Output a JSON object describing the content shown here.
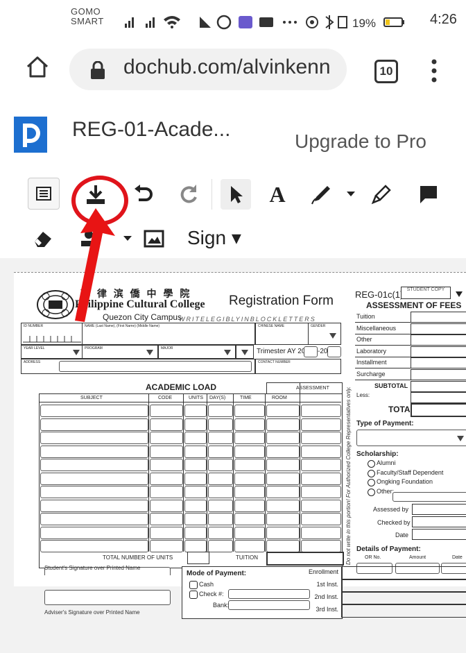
{
  "status_bar": {
    "carrier_line1": "GOMO",
    "carrier_line2": "SMART",
    "icons_text": "▐ıl ▐ıl ◥ ≡ ✓ ◎ ■ ▶ ··· ◉ ✱ ▯ 19%",
    "battery": "19%",
    "time": "4:26"
  },
  "browser": {
    "url": "dochub.com/alvinkenn",
    "tab_count": "10"
  },
  "app": {
    "doc_title": "REG-01-Acade...",
    "upgrade_label": "Upgrade to Pro",
    "sign_label": "Sign ▾"
  },
  "form": {
    "school_chinese": "菲 律 滨 僑 中 學 院",
    "school_name": "Philippine Cultural College",
    "campus": "Quezon City Campus",
    "write_note": "WRITELEGIBLYINBLOCKLETTERS",
    "form_title": "Registration Form",
    "form_code": "REG-01c(1)",
    "copy_label": "STUDENT COPY",
    "id_label": "ID NUMBER",
    "name_label": "NAME (Last Name), (First Name) (Middle Name)",
    "chinese_name_label": "CHINESE NAME",
    "gender_label": "GENDER",
    "year_level_label": "YEAR LEVEL",
    "program_label": "PROGRAM",
    "major_label": "MAJOR",
    "trimester_label": "Trimester AY 20",
    "trimester_dash": "-20",
    "address_label": "ADDRESS",
    "contact_label": "CONTACT NUMBER",
    "academic_load": "ACADEMIC LOAD",
    "assessment_col": "ASSESSMENT",
    "columns": [
      "SUBJECT",
      "CODE",
      "UNITS",
      "DAY(S)",
      "TIME",
      "ROOM"
    ],
    "total_units_label": "TOTAL NUMBER OF UNITS",
    "tuition_label": "TUITION",
    "student_sig": "Student's Signature over Printed Name",
    "adviser_sig": "Adviser's Signature over Printed Name",
    "mode_of_payment": "Mode of Payment:",
    "cash_label": "Cash",
    "check_label": "Check #:",
    "bank_label": "Bank:",
    "installments": [
      "Enrollment",
      "1st Inst.",
      "2nd Inst.",
      "3rd Inst."
    ],
    "vertical_note": "Do not write in this portion! For Authorized College Representatives only.",
    "assessment_fees": "ASSESSMENT OF FEES",
    "fee_items": [
      "Tuition",
      "Miscellaneous",
      "Other",
      "Laboratory",
      "Installment",
      "Surcharge"
    ],
    "subtotal_label": "SUBTOTAL",
    "less_label": "Less:",
    "total_label": "TOTAL",
    "type_of_payment": "Type of Payment:",
    "scholarship": "Scholarship:",
    "scholarship_options": [
      "Alumni",
      "Faculty/Staff Dependent",
      "Ongking Foundation",
      "Other:"
    ],
    "assessed_by": "Assessed by",
    "checked_by": "Checked by",
    "date_label": "Date",
    "details_of_payment": "Details of Payment:",
    "payment_cols": [
      "OR No.",
      "Amount",
      "Date"
    ]
  }
}
